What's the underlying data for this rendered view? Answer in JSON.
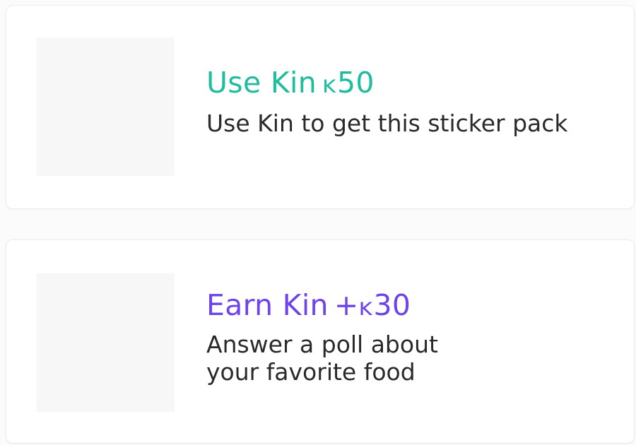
{
  "colors": {
    "spend_accent": "#1fbd9b",
    "earn_accent": "#6e44ea",
    "text": "#2a2a2a",
    "thumb_placeholder": "#f7f7f7"
  },
  "offers": [
    {
      "title_label": "Use Kin",
      "amount_prefix": "",
      "currency_glyph": "ĸ",
      "amount_value": "50",
      "description": "Use Kin to get this sticker pack"
    },
    {
      "title_label": "Earn Kin",
      "amount_prefix": "+",
      "currency_glyph": "ĸ",
      "amount_value": "30",
      "description": "Answer a poll about\nyour favorite food"
    }
  ]
}
